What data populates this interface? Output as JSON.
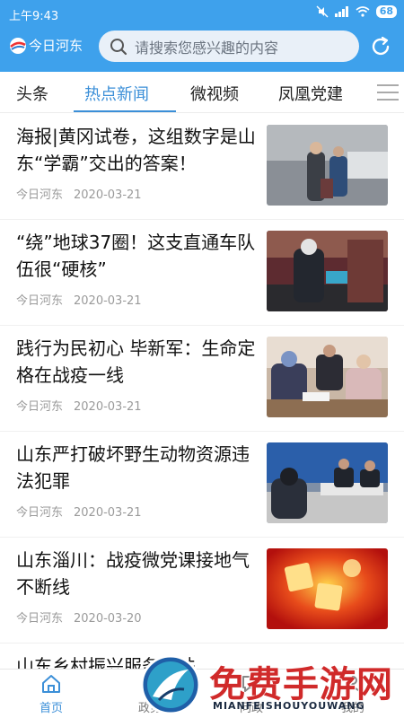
{
  "status": {
    "time": "上午9:43",
    "battery": "68"
  },
  "header": {
    "logo_text": "今日河东",
    "search_placeholder": "请搜索您感兴趣的内容"
  },
  "tabs": [
    {
      "label": "头条"
    },
    {
      "label": "热点新闻"
    },
    {
      "label": "微视频"
    },
    {
      "label": "凤凰党建"
    }
  ],
  "news": [
    {
      "title": "海报|黄冈试卷，这组数字是山东“学霸”交出的答案！",
      "source": "今日河东",
      "date": "2020-03-21"
    },
    {
      "title": "“绕”地球37圈！这支直通车队伍很“硬核”",
      "source": "今日河东",
      "date": "2020-03-21"
    },
    {
      "title": "践行为民初心 毕新军：生命定格在战疫一线",
      "source": "今日河东",
      "date": "2020-03-21"
    },
    {
      "title": "山东严打破坏野生动物资源违法犯罪",
      "source": "今日河东",
      "date": "2020-03-21"
    },
    {
      "title": "山东淄川：战疫微党课接地气不断线",
      "source": "今日河东",
      "date": "2020-03-20"
    },
    {
      "title": "山东乡村振兴服务帮扶",
      "source": "",
      "date": ""
    }
  ],
  "bottom_nav": [
    {
      "label": "首页"
    },
    {
      "label": "政务"
    },
    {
      "label": "问政"
    },
    {
      "label": "我的"
    }
  ],
  "watermark": {
    "text": "免费手游网",
    "sub": "MIANFEISHOUYOUWANG"
  },
  "colors": {
    "header_blue": "#3ea1ec",
    "accent_blue": "#3b8fd8",
    "watermark_red": "#d02a2a"
  }
}
